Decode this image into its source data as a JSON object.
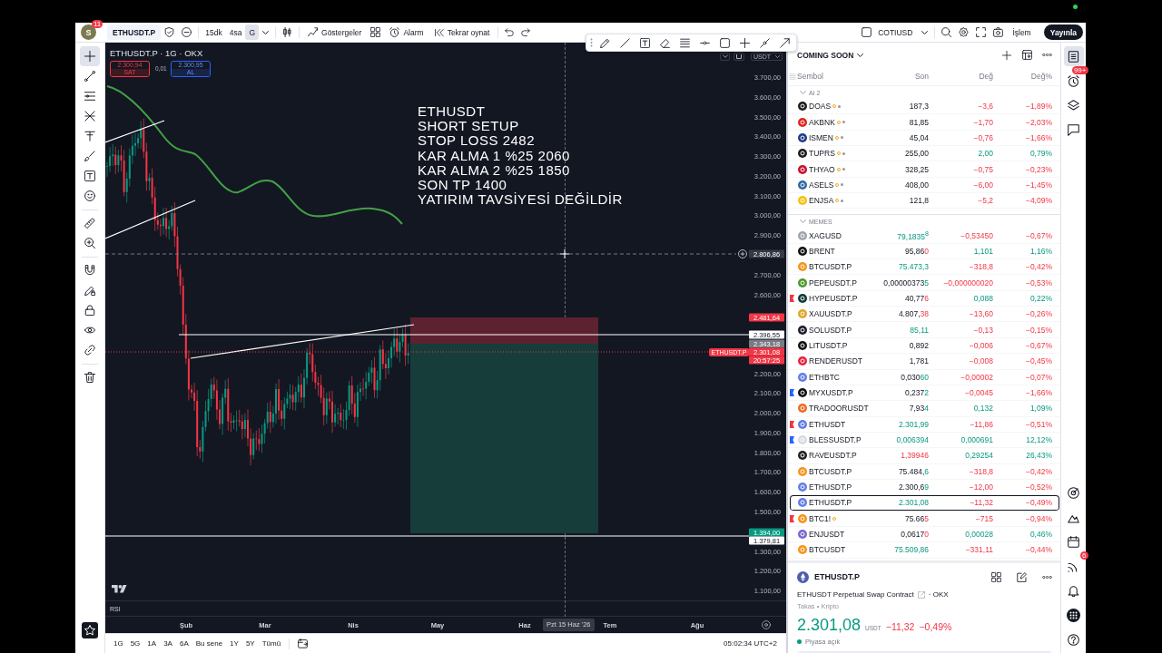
{
  "toolbar": {
    "avatar": {
      "letter": "S",
      "badge": "11"
    },
    "symbol": "ETHUSDT.P",
    "intervals": [
      {
        "label": "15dk",
        "selected": false
      },
      {
        "label": "4sa",
        "selected": false
      },
      {
        "label": "G",
        "selected": true
      }
    ],
    "indicators": "Göstergeler",
    "alert": "Alarm",
    "replay": "Tekrar oynat",
    "layout": "COTIUSD",
    "trade": "İşlem",
    "publish": "Yayınla"
  },
  "left_tools": [
    {
      "selected": true
    },
    {
      "selected": false
    },
    {
      "selected": false
    },
    {
      "selected": false
    },
    {
      "selected": false
    },
    {
      "selected": false
    },
    {
      "selected": false
    },
    {
      "selected": false
    },
    {
      "selected": false
    },
    {
      "selected": false
    },
    {
      "selected": false
    },
    {
      "selected": false
    },
    {
      "selected": false
    },
    {
      "selected": false
    },
    {
      "selected": false
    },
    {
      "selected": false
    }
  ],
  "chart": {
    "title": "ETHUSDT.P · 1G · OKX",
    "sell": {
      "price": "2.300,94",
      "label": "SAT"
    },
    "spread": "0,01",
    "buy": {
      "price": "2.300,95",
      "label": "AL"
    },
    "currency": "USDT",
    "note": [
      "ETHUSDT",
      "SHORT SETUP",
      "STOP LOSS 2482",
      "KAR ALMA 1 %25 2060",
      "KAR ALMA 2 %25 1850",
      "SON TP 1400",
      "YATIRIM TAVSİYESİ DEĞİLDİR"
    ],
    "price_labels": [
      "3.700,00",
      "3.600,00",
      "3.500,00",
      "3.400,00",
      "3.300,00",
      "3.200,00",
      "3.100,00",
      "3.000,00",
      "2.900,00",
      "2.700,00",
      "2.600,00",
      "2.200,00",
      "2.100,00",
      "2.000,00",
      "1.900,00",
      "1.800,00",
      "1.700,00",
      "1.600,00",
      "1.500,00",
      "1.300,00",
      "1.200,00",
      "1.100,00"
    ],
    "price_tags": [
      {
        "kind": "crosshair",
        "text": "2.806,86"
      },
      {
        "kind": "stop",
        "text": "2.481,64"
      },
      {
        "kind": "line",
        "text": "2.396,55"
      },
      {
        "kind": "entry",
        "text": "2.343,18"
      },
      {
        "kind": "last",
        "text": "2.301,08"
      },
      {
        "kind": "countdown",
        "text": "20:57:25"
      },
      {
        "kind": "target",
        "text": "1.394,00"
      },
      {
        "kind": "line",
        "text": "1.379,81"
      }
    ],
    "symbol_tag": "ETHUSDT.P",
    "indicator": "RSI",
    "time_labels": [
      "Şub",
      "Mar",
      "Nis",
      "May",
      "Haz",
      "Tem",
      "Ağu"
    ],
    "crosshair_date": "Pzt 15 Haz '26"
  },
  "range_bar": {
    "ranges": [
      "1G",
      "5G",
      "1A",
      "3A",
      "6A",
      "Bu sene",
      "1Y",
      "5Y",
      "Tümü"
    ],
    "clock": "05:02:34 UTC+2"
  },
  "watchlist": {
    "title": "COMING SOON",
    "columns": [
      "Sembol",
      "Son",
      "Değ",
      "Değ%"
    ],
    "groups": [
      {
        "name": "AI 2",
        "expanded": true,
        "rows": [
          {
            "symbol": "DOAS",
            "color": "#1c1c1c",
            "delayed": true,
            "closed": true,
            "last": {
              "text": "187,3",
              "kind": "plain"
            },
            "change": {
              "text": "−3,6",
              "kind": "down"
            },
            "percent": {
              "text": "−1,89%",
              "kind": "down"
            },
            "selected": false
          },
          {
            "symbol": "AKBNK",
            "color": "#e2231a",
            "delayed": true,
            "closed": true,
            "last": {
              "text": "81,85",
              "kind": "plain"
            },
            "change": {
              "text": "−1,70",
              "kind": "down"
            },
            "percent": {
              "text": "−2,03%",
              "kind": "down"
            },
            "selected": false
          },
          {
            "symbol": "ISMEN",
            "color": "#1f3c88",
            "delayed": true,
            "closed": true,
            "last": {
              "text": "45,04",
              "kind": "plain"
            },
            "change": {
              "text": "−0,76",
              "kind": "down"
            },
            "percent": {
              "text": "−1,66%",
              "kind": "down"
            },
            "selected": false
          },
          {
            "symbol": "TUPRS",
            "color": "#1c1c1c",
            "delayed": true,
            "closed": true,
            "last": {
              "text": "255,00",
              "kind": "plain"
            },
            "change": {
              "text": "2,00",
              "kind": "up"
            },
            "percent": {
              "text": "0,79%",
              "kind": "up"
            },
            "selected": false
          },
          {
            "symbol": "THYAO",
            "color": "#c8102e",
            "delayed": true,
            "closed": true,
            "last": {
              "text": "328,25",
              "kind": "plain"
            },
            "change": {
              "text": "−0,75",
              "kind": "down"
            },
            "percent": {
              "text": "−0,23%",
              "kind": "down"
            },
            "selected": false
          },
          {
            "symbol": "ASELS",
            "color": "#2e6aa6",
            "delayed": true,
            "closed": true,
            "last": {
              "text": "408,00",
              "kind": "plain"
            },
            "change": {
              "text": "−6,00",
              "kind": "down"
            },
            "percent": {
              "text": "−1,45%",
              "kind": "down"
            },
            "selected": false
          },
          {
            "symbol": "ENJSA",
            "color": "#f4c20d",
            "delayed": true,
            "closed": true,
            "last": {
              "text": "121,8",
              "kind": "plain"
            },
            "change": {
              "text": "−5,2",
              "kind": "down"
            },
            "percent": {
              "text": "−4,09%",
              "kind": "down"
            },
            "selected": false
          }
        ]
      },
      {
        "name": "MEMES",
        "expanded": true,
        "rows": [
          {
            "symbol": "XAGUSD",
            "color": "#9ea3ad",
            "delayed": false,
            "closed": false,
            "last": {
              "text": "79,1835$^{8}$",
              "kind": "up"
            },
            "change": {
              "text": "−0,53450",
              "kind": "down"
            },
            "percent": {
              "text": "−0,67%",
              "kind": "down"
            },
            "selected": false
          },
          {
            "symbol": "BRENT",
            "color": "#111111",
            "delayed": false,
            "closed": false,
            "last": {
              "text": "95,86",
              "kind": "plain"
            },
            "tick": {
              "text": "0",
              "kind": "down"
            },
            "change": {
              "text": "1,101",
              "kind": "up"
            },
            "percent": {
              "text": "1,16%",
              "kind": "up"
            },
            "selected": false
          },
          {
            "symbol": "BTCUSDT.P",
            "color": "#f7931a",
            "delayed": false,
            "closed": false,
            "last": {
              "text": "75.473,3",
              "kind": "up"
            },
            "change": {
              "text": "−318,8",
              "kind": "down"
            },
            "percent": {
              "text": "−0,42%",
              "kind": "down"
            },
            "selected": false
          },
          {
            "symbol": "PEPEUSDT.P",
            "color": "#4c9a2a",
            "delayed": false,
            "closed": false,
            "last": {
              "text": "0,00000373",
              "kind": "plain"
            },
            "tick": {
              "text": "5",
              "kind": "up"
            },
            "change": {
              "text": "−0,000000020",
              "kind": "down"
            },
            "percent": {
              "text": "−0,53%",
              "kind": "down"
            },
            "selected": false
          },
          {
            "symbol": "HYPEUSDT.P",
            "color": "#0f3b37",
            "flag": {
              "color": "#f23645"
            },
            "delayed": false,
            "closed": false,
            "last": {
              "text": "40,77",
              "kind": "plain"
            },
            "tick": {
              "text": "6",
              "kind": "down"
            },
            "change": {
              "text": "0,088",
              "kind": "up"
            },
            "percent": {
              "text": "0,22%",
              "kind": "up"
            },
            "selected": false
          },
          {
            "symbol": "XAUUSDT.P",
            "color": "#e0a526",
            "delayed": false,
            "closed": false,
            "last": {
              "text": "4.807,",
              "kind": "plain"
            },
            "tick": {
              "text": "38",
              "kind": "down"
            },
            "change": {
              "text": "−13,60",
              "kind": "down"
            },
            "percent": {
              "text": "−0,26%",
              "kind": "down"
            },
            "selected": false
          },
          {
            "symbol": "SOLUSDT.P",
            "color": "#1c1c2a",
            "delayed": false,
            "closed": false,
            "last": {
              "text": "85,11",
              "kind": "up"
            },
            "change": {
              "text": "−0,13",
              "kind": "down"
            },
            "percent": {
              "text": "−0,15%",
              "kind": "down"
            },
            "selected": false
          },
          {
            "symbol": "LITUSDT.P",
            "color": "#111111",
            "delayed": false,
            "closed": false,
            "last": {
              "text": "0,892",
              "kind": "plain"
            },
            "change": {
              "text": "−0,006",
              "kind": "down"
            },
            "percent": {
              "text": "−0,67%",
              "kind": "down"
            },
            "selected": false
          },
          {
            "symbol": "RENDERUSDT",
            "color": "#e8213a",
            "delayed": false,
            "closed": false,
            "last": {
              "text": "1,781",
              "kind": "plain"
            },
            "change": {
              "text": "−0,008",
              "kind": "down"
            },
            "percent": {
              "text": "−0,45%",
              "kind": "down"
            },
            "selected": false
          },
          {
            "symbol": "ETHBTC",
            "color": "#627eea",
            "delayed": false,
            "closed": false,
            "last": {
              "text": "0,030",
              "kind": "plain"
            },
            "tick": {
              "text": "60",
              "kind": "up"
            },
            "change": {
              "text": "−0,00002",
              "kind": "down"
            },
            "percent": {
              "text": "−0,07%",
              "kind": "down"
            },
            "selected": false
          },
          {
            "symbol": "MYXUSDT.P",
            "color": "#111111",
            "flag": {
              "color": "#2962ff"
            },
            "delayed": false,
            "closed": false,
            "last": {
              "text": "0,237",
              "kind": "plain"
            },
            "tick": {
              "text": "2",
              "kind": "up"
            },
            "change": {
              "text": "−0,0045",
              "kind": "down"
            },
            "percent": {
              "text": "−1,66%",
              "kind": "down"
            },
            "selected": false
          },
          {
            "symbol": "TRADOORUSDT",
            "color": "#f06a25",
            "delayed": false,
            "closed": false,
            "last": {
              "text": "7,93",
              "kind": "plain"
            },
            "tick": {
              "text": "4",
              "kind": "up"
            },
            "change": {
              "text": "0,132",
              "kind": "up"
            },
            "percent": {
              "text": "1,09%",
              "kind": "up"
            },
            "selected": false
          },
          {
            "symbol": "ETHUSDT",
            "color": "#627eea",
            "flag": {
              "color": "#f23645"
            },
            "delayed": false,
            "closed": false,
            "last": {
              "text": "2.301,99",
              "kind": "up"
            },
            "change": {
              "text": "−11,86",
              "kind": "down"
            },
            "percent": {
              "text": "−0,51%",
              "kind": "down"
            },
            "selected": false
          },
          {
            "symbol": "BLESSUSDT.P",
            "color": "#d9dbe3",
            "flag": {
              "color": "#2962ff"
            },
            "delayed": false,
            "closed": false,
            "last": {
              "text": "0,006394",
              "kind": "up"
            },
            "change": {
              "text": "0,000691",
              "kind": "up"
            },
            "percent": {
              "text": "12,12%",
              "kind": "up"
            },
            "selected": false
          },
          {
            "symbol": "RAVEUSDT.P",
            "color": "#222222",
            "delayed": false,
            "closed": false,
            "last": {
              "text": "1,39946",
              "kind": "down"
            },
            "change": {
              "text": "0,29254",
              "kind": "up"
            },
            "percent": {
              "text": "26,43%",
              "kind": "up"
            },
            "selected": false
          },
          {
            "symbol": "BTCUSDT.P",
            "color": "#f7931a",
            "delayed": false,
            "closed": false,
            "last": {
              "text": "75.484,",
              "kind": "plain"
            },
            "tick": {
              "text": "6",
              "kind": "up"
            },
            "change": {
              "text": "−318,8",
              "kind": "down"
            },
            "percent": {
              "text": "−0,42%",
              "kind": "down"
            },
            "selected": false
          },
          {
            "symbol": "ETHUSDT.P",
            "color": "#627eea",
            "delayed": false,
            "closed": false,
            "last": {
              "text": "2.300,6",
              "kind": "plain"
            },
            "tick": {
              "text": "9",
              "kind": "up"
            },
            "change": {
              "text": "−12,00",
              "kind": "down"
            },
            "percent": {
              "text": "−0,52%",
              "kind": "down"
            },
            "selected": false
          },
          {
            "symbol": "ETHUSDT.P",
            "color": "#627eea",
            "delayed": false,
            "closed": false,
            "last": {
              "text": "2.301,08",
              "kind": "up"
            },
            "change": {
              "text": "−11,32",
              "kind": "down"
            },
            "percent": {
              "text": "−0,49%",
              "kind": "down"
            },
            "selected": true
          },
          {
            "symbol": "BTC1!",
            "color": "#f7931a",
            "flag": {
              "color": "#f23645"
            },
            "delayed": true,
            "closed": false,
            "last": {
              "text": "75.66",
              "kind": "plain"
            },
            "tick": {
              "text": "5",
              "kind": "down"
            },
            "change": {
              "text": "−715",
              "kind": "down"
            },
            "percent": {
              "text": "−0,94%",
              "kind": "down"
            },
            "selected": false
          },
          {
            "symbol": "ENJUSDT",
            "color": "#7866d5",
            "delayed": false,
            "closed": false,
            "last": {
              "text": "0,0617",
              "kind": "plain"
            },
            "tick": {
              "text": "0",
              "kind": "down"
            },
            "change": {
              "text": "0,00028",
              "kind": "up"
            },
            "percent": {
              "text": "0,46%",
              "kind": "up"
            },
            "selected": false
          },
          {
            "symbol": "BTCUSDT",
            "color": "#f7931a",
            "delayed": false,
            "closed": false,
            "last": {
              "text": "75.509,86",
              "kind": "up"
            },
            "change": {
              "text": "−331,11",
              "kind": "down"
            },
            "percent": {
              "text": "−0,44%",
              "kind": "down"
            },
            "selected": false
          }
        ]
      }
    ]
  },
  "details": {
    "symbol": "ETHUSDT.P",
    "description": "ETHUSDT Perpetual Swap Contract",
    "exchange": "· OKX",
    "category": "Takas • Kripto",
    "price": {
      "text": "2.301,08",
      "kind": "up"
    },
    "currency": "USDT",
    "change": {
      "text": "−11,32",
      "kind": "down"
    },
    "percent": {
      "text": "−0,49%",
      "kind": "down"
    },
    "status": "Piyasa açık",
    "market_open": true
  },
  "right_rail": {
    "top": [
      {
        "selected": true
      },
      {
        "selected": false,
        "badge": "99+"
      },
      {
        "selected": false
      },
      {
        "selected": false
      }
    ],
    "bottom": [
      {
        "selected": false
      },
      {
        "selected": false
      },
      {
        "selected": false
      },
      {
        "selected": false,
        "badge": "6"
      },
      {
        "selected": false
      },
      {
        "selected": false
      },
      {
        "selected": false
      }
    ]
  }
}
